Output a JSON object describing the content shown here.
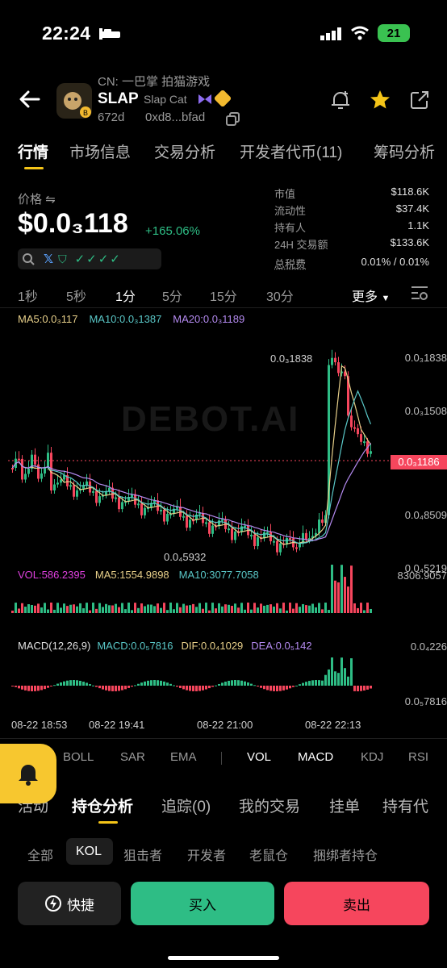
{
  "status_bar": {
    "time": "22:24",
    "battery": "21"
  },
  "header": {
    "cn_label": "CN: 一巴掌 拍猫游戏",
    "symbol": "SLAP",
    "name": "Slap Cat",
    "age": "672d",
    "contract": "0xd8...bfad"
  },
  "tabs": [
    "行情",
    "市场信息",
    "交易分析",
    "开发者代币(11)",
    "筹码分析"
  ],
  "price_panel": {
    "label": "价格",
    "price": "$0.0₃118",
    "change": "+165.06%",
    "stats": [
      {
        "label": "市值",
        "value": "$118.6K"
      },
      {
        "label": "流动性",
        "value": "$37.4K"
      },
      {
        "label": "持有人",
        "value": "1.1K"
      },
      {
        "label": "24H 交易额",
        "value": "$133.6K"
      },
      {
        "label": "总税费",
        "value": "0.01% / 0.01%"
      }
    ]
  },
  "intervals": [
    "1秒",
    "5秒",
    "1分",
    "5分",
    "15分",
    "30分"
  ],
  "interval_active": "1分",
  "more_label": "更多",
  "chart": {
    "ma5": "MA5:0.0₃117",
    "ma10": "MA10:0.0₃1387",
    "ma20": "MA20:0.0₃1189",
    "y_labels": [
      "0.0₃1838",
      "0.0₃1508",
      "0.0₄8509",
      "0.0₄5219"
    ],
    "current_price": "0.0₃1186",
    "high_label": "0.0₃1838",
    "low_label": "0.0₄5932",
    "watermark": "DEBOT.AI",
    "vol": "VOL:586.2395",
    "vol_ma5": "MA5:1554.9898",
    "vol_ma10": "MA10:3077.7058",
    "vol_max": "8306.9057",
    "macd_label": "MACD(12,26,9)",
    "macd": "MACD:0.0₅7816",
    "dif": "DIF:0.0₄1029",
    "dea": "DEA:0.0₅142",
    "macd_top": "0.0₄226",
    "macd_bottom": "0.0₅7816",
    "x_labels": [
      "08-22 18:53",
      "08-22 19:41",
      "08-22 21:00",
      "08-22 22:13"
    ]
  },
  "indicators": [
    "BOLL",
    "SAR",
    "EMA",
    "VOL",
    "MACD",
    "KDJ",
    "RSI"
  ],
  "bottom_tabs": [
    "活动",
    "持仓分析",
    "追踪(0)",
    "我的交易",
    "挂单",
    "持有代"
  ],
  "filters": [
    "全部",
    "KOL",
    "狙击者",
    "开发者",
    "老鼠仓",
    "捆绑者持仓"
  ],
  "actions": {
    "quick": "快捷",
    "buy": "买入",
    "sell": "卖出"
  },
  "colors": {
    "up": "#2ebd85",
    "down": "#f6465d",
    "accent": "#f5c518"
  }
}
